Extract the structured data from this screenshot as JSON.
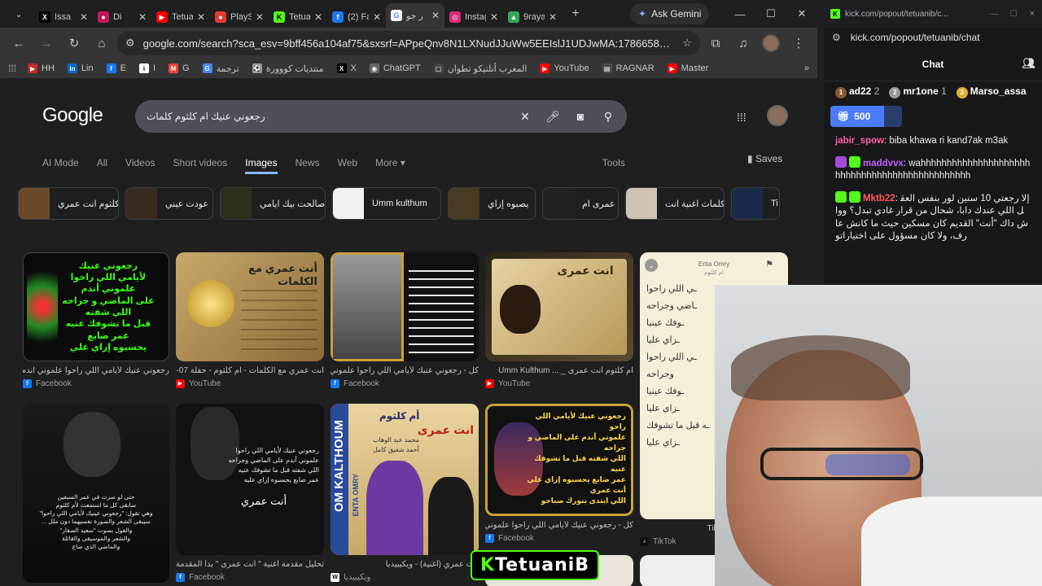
{
  "browser": {
    "tabs": [
      {
        "label": "Issa",
        "icon": "x-icon",
        "color": "#000000",
        "glyph": "X"
      },
      {
        "label": "Di",
        "icon": "chrome-icon",
        "color": "#c2185b",
        "glyph": "●"
      },
      {
        "label": "Tetuani",
        "icon": "youtube-icon",
        "color": "#ff0000",
        "glyph": "▶"
      },
      {
        "label": "PlaySta",
        "icon": "playstation-icon",
        "color": "#e53935",
        "glyph": "●"
      },
      {
        "label": "Tetuani",
        "icon": "kick-icon",
        "color": "#53fc18",
        "glyph": "K"
      },
      {
        "label": "(2) Face",
        "icon": "facebook-icon",
        "color": "#1877f2",
        "glyph": "f"
      },
      {
        "label": "ر جو",
        "icon": "google-icon",
        "color": "#ffffff",
        "glyph": "G",
        "active": true
      },
      {
        "label": "Instagr",
        "icon": "instagram-icon",
        "color": "#d62976",
        "glyph": "◎"
      },
      {
        "label": "9raya f",
        "icon": "drive-icon",
        "color": "#34a853",
        "glyph": "▲"
      }
    ],
    "gemini_label": "Ask Gemini",
    "url": "google.com/search?sca_esv=9bff456a104af75&sxsrf=APpeQnv8N1LXNudJJuWw5EEIslJ1UDJwMA:1786658518108&udm=2...",
    "bookmarks": [
      {
        "label": "HH",
        "color": "#c62828",
        "glyph": "▶"
      },
      {
        "label": "Lin",
        "color": "#0a66c2",
        "glyph": "in"
      },
      {
        "label": "E",
        "color": "#1877f2",
        "glyph": "f"
      },
      {
        "label": "I",
        "color": "#ffffff",
        "glyph": "i"
      },
      {
        "label": "G",
        "color": "#ea4335",
        "glyph": "M"
      },
      {
        "label": "ترجمة",
        "color": "#4285f4",
        "glyph": "G"
      },
      {
        "label": "منتديات كووورة",
        "color": "#999999",
        "glyph": "⚽"
      },
      {
        "label": "X",
        "color": "#000000",
        "glyph": "X"
      },
      {
        "label": "ChatGPT",
        "color": "#666666",
        "glyph": "◉"
      },
      {
        "label": "المغرب أتلتيكو تطوان",
        "color": "#444444",
        "glyph": "▢"
      },
      {
        "label": "YouTube",
        "color": "#ff0000",
        "glyph": "▶"
      },
      {
        "label": "RAGNAR",
        "color": "#4a4a4a",
        "glyph": "▤"
      },
      {
        "label": "Master",
        "color": "#ff0000",
        "glyph": "▶"
      }
    ]
  },
  "google": {
    "logo": "Google",
    "query": "رجعوني عنيك ام كلثوم كلمات",
    "nav": [
      "AI Mode",
      "All",
      "Videos",
      "Short videos",
      "Images",
      "News",
      "Web",
      "More"
    ],
    "nav_active": "Images",
    "tools": "Tools",
    "saves": "Saves",
    "chips": [
      {
        "label": "كلثوم انت عمري",
        "w": 124,
        "bg": "#6b4a2a"
      },
      {
        "label": "عودت عيني",
        "w": 108,
        "bg": "#3a2a1e"
      },
      {
        "label": "صالحت بيك ايامي",
        "w": 130,
        "bg": "#2a2f1a"
      },
      {
        "label": "Umm kulthum",
        "w": 134,
        "bg": "#f2f2f2"
      },
      {
        "label": "يصبوه إزاي",
        "w": 108,
        "bg": "#4a3a22"
      },
      {
        "label": "عمرى ام",
        "w": 94,
        "bg": "#222"
      },
      {
        "label": "كلمات اغنية انت",
        "w": 122,
        "bg": "#cfc4b4"
      },
      {
        "label": "Ti",
        "w": 60,
        "bg": "#1a2a4a"
      }
    ],
    "results": [
      {
        "caption": "رجعوني عنيك لأيامي اللي راحوا علموني اندم على",
        "source": "Facebook",
        "src_color": "#1877f2",
        "src_glyph": "f"
      },
      {
        "caption": "انت عمري مع الكلمات - ام كلثوم - حفلة 07-05-",
        "source": "YouTube",
        "src_color": "#ff0000",
        "src_glyph": "▶"
      },
      {
        "caption": "كل - رجعوني عنيك لأيامي اللي راحوا علموني اندم ...",
        "source": "Facebook",
        "src_color": "#1877f2",
        "src_glyph": "f"
      },
      {
        "caption": "ام كلثوم انت عمرى _ ... Umm Kulthum",
        "source": "YouTube",
        "src_color": "#ff0000",
        "src_glyph": "▶"
      },
      {
        "caption": "حزينة لأم كلثوم | TikTok",
        "source": "TikTok",
        "src_color": "#111111",
        "src_glyph": "♪"
      },
      {
        "caption": "",
        "source": "",
        "src_color": "#1877f2",
        "src_glyph": "f"
      },
      {
        "caption": "تحليل مقدمة أغنية \" انت عمرى \" بدأ المقدمة الهادئة",
        "source": "Facebook",
        "src_color": "#1877f2",
        "src_glyph": "f"
      },
      {
        "caption": "إنت عمري (أغنية) - ويكيبيديا",
        "source": "ويكيبيديا",
        "src_color": "#ffffff",
        "src_glyph": "W"
      },
      {
        "caption": "كل - رجعوني عنيك لأيامي اللي راحوا علموني اندم ...",
        "source": "Facebook",
        "src_color": "#1877f2",
        "src_glyph": "f"
      }
    ],
    "poster_lines": [
      "رجعوني عنيك",
      "لأيامي اللي راحوا",
      "علموني أندم",
      "على الماضي و جراحه",
      "اللي شفته",
      "قبل ما تشوفك عنيه",
      "عمر ضايع",
      "يحسبوه إزاي علي"
    ],
    "poster2_title": "أنت عمري مع الكلمات",
    "poster4_title": "انت عمرى",
    "tall_card": {
      "title": "Enta Omry",
      "subtitle": "ام كلثوم"
    },
    "tall_lines": [
      "ـي اللي راحوا",
      "ـاضي وجراحه",
      "ـوفك عينيا",
      "ـزاي عليا",
      "ـي اللي راحوا",
      "وجراحه",
      "ـوفك عينيا",
      "ـزاي عليا",
      "ـه قبل ما تشوفك",
      "ـزاي عليا"
    ],
    "album_title": "OM KALTHOUM",
    "album_sub": "ENTA OMRY",
    "album_ar": "أم كلثوم",
    "album_ar2": "انت عمرى",
    "album_composer": "محمد عبد الوهاب",
    "album_lyricist": "أحمد شفيق كامل",
    "r8_lines": [
      "رجعوني عنيك لأيامي اللي راحو",
      "علموني أندم على الماضي و جراحه",
      "اللي شفته قبل ما تشوفك عنيه",
      "عمر ضايع يحسبوه إزاي علي",
      "أنت عمري",
      "اللي ابتدى بنورك صباحو"
    ],
    "r7_lines": [
      "رجعوني عنيك لأيامي اللي راحوا",
      "علموني أندم على الماضي وجراحه",
      "اللي شفته قبل ما تشوفك عنيه",
      "عمر ضايع يحسبوه إزاي عليه"
    ],
    "r7_sign": "أنت عمري",
    "r6_lines": [
      "حتى لو صرت في عمر السبعين",
      "سابقى كل ما استمعت لأم كلثوم",
      "وهي تقول: \"رجعوني عينيك لأيامي اللي راحوا\"",
      "سيبقى الشعر والصورة نفسيهما دون ملل ...",
      "والقول بصوت \"سعيد الصقار\"",
      "والشعر والموسيقى والقائلة",
      "والماضي الذي ضاع"
    ]
  },
  "chat": {
    "window_url": "kick.com/popout/tetuanib/c...",
    "url": "kick.com/popout/tetuanib/chat",
    "title": "Chat",
    "leaders": [
      {
        "name": "ad22",
        "count": "2"
      },
      {
        "name": "mr1one",
        "count": "1"
      },
      {
        "name": "Marso_assa",
        "count": ""
      }
    ],
    "gift_amount": "500",
    "messages": [
      {
        "user": "jabir_spow",
        "color": "#ff5fa2",
        "sep": ": ",
        "text": "biba khawa ri kand7ak m3ak",
        "badges": []
      },
      {
        "user": "maddvvx",
        "color": "#c45cff",
        "sep": ": ",
        "text": "wahhhhhhhhhhhhhhhhhhhhhhhhhhhhhhhhhhhhhhhhhhhhhhh",
        "badges": [
          "#a64bd8",
          "#53fc18"
        ]
      },
      {
        "user": "Mktb22",
        "color": "#ff5a5a",
        "sep": ": ",
        "text": "إلا رجعتي 10 سنين لور بنفس العقل اللي عندك دابا، شحال من قرار غادي تبدل؟ وواش داك \"أنت\" القديم كان مسكين حيث ما كانش عارف، ولا كان مسؤول على اختياراتو",
        "badges": [
          "#53fc18",
          "#53fc18"
        ]
      }
    ]
  },
  "stream": {
    "watermark": "TetuaniB",
    "watermark_k": "K"
  }
}
